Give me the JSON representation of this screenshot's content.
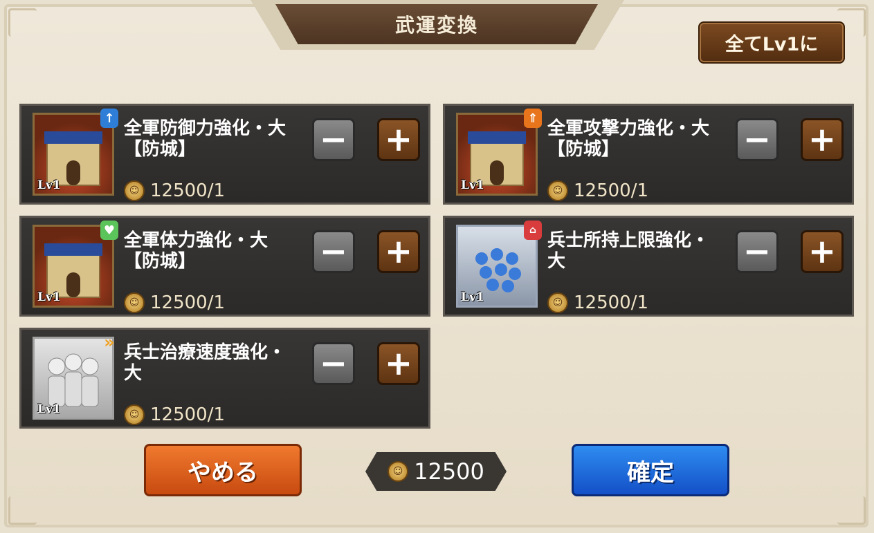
{
  "title": "武運変換",
  "all_lv1_button": "全てLv1に",
  "cards": [
    {
      "name_line1": "全軍防御力強化・大",
      "name_line2": "【防城】",
      "level": "Lv1",
      "cost": "12500/1",
      "badge": "↑"
    },
    {
      "name_line1": "全軍攻撃力強化・大",
      "name_line2": "【防城】",
      "level": "Lv1",
      "cost": "12500/1",
      "badge": "⇑"
    },
    {
      "name_line1": "全軍体力強化・大",
      "name_line2": "【防城】",
      "level": "Lv1",
      "cost": "12500/1",
      "badge": "♥"
    },
    {
      "name_line1": "兵士所持上限強化・",
      "name_line2": "大",
      "level": "Lv1",
      "cost": "12500/1",
      "badge": "⌂"
    },
    {
      "name_line1": "兵士治療速度強化・",
      "name_line2": "大",
      "level": "Lv1",
      "cost": "12500/1",
      "badge": "»"
    }
  ],
  "buttons": {
    "minus": "−",
    "plus": "+",
    "cancel": "やめる",
    "confirm": "確定"
  },
  "total_cost": "12500",
  "icons": {
    "coin": "coin-icon",
    "minus": "minus-icon",
    "plus": "plus-icon"
  }
}
